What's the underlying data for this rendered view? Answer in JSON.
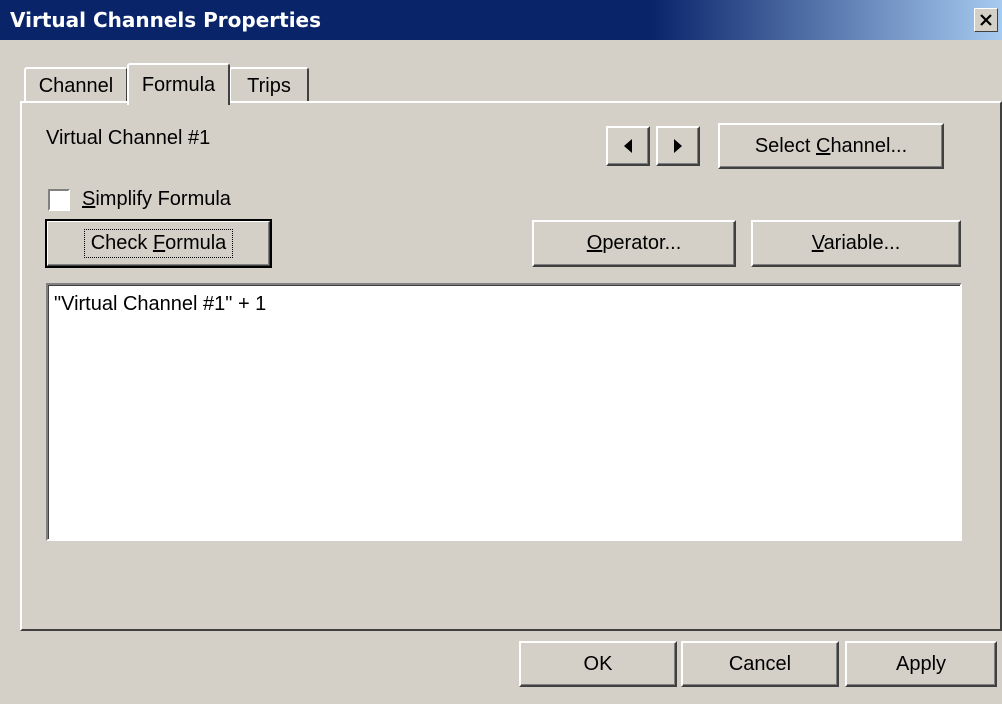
{
  "window": {
    "title": "Virtual Channels Properties",
    "close_icon": "close-icon"
  },
  "tabs": [
    {
      "label": "Channel",
      "active": false
    },
    {
      "label": "Formula",
      "active": true
    },
    {
      "label": "Trips",
      "active": false
    }
  ],
  "formula_tab": {
    "channel_name": "Virtual Channel #1",
    "prev_icon": "triangle-left-icon",
    "next_icon": "triangle-right-icon",
    "select_channel": {
      "pre": "Select ",
      "key": "C",
      "post": "hannel..."
    },
    "simplify": {
      "pre": "",
      "key": "S",
      "post": "implify Formula",
      "checked": false
    },
    "check_formula": {
      "pre": "Check ",
      "key": "F",
      "post": "ormula"
    },
    "operator": {
      "pre": "",
      "key": "O",
      "post": "perator..."
    },
    "variable": {
      "pre": "",
      "key": "V",
      "post": "ariable..."
    },
    "formula_text": "\"Virtual Channel #1\" + 1"
  },
  "footer": {
    "ok_label": "OK",
    "cancel_label": "Cancel",
    "apply_label": "Apply"
  },
  "colors": {
    "face": "#d4d0c8",
    "title_active": "#0a246a",
    "title_gradient_end": "#a6caf0"
  }
}
